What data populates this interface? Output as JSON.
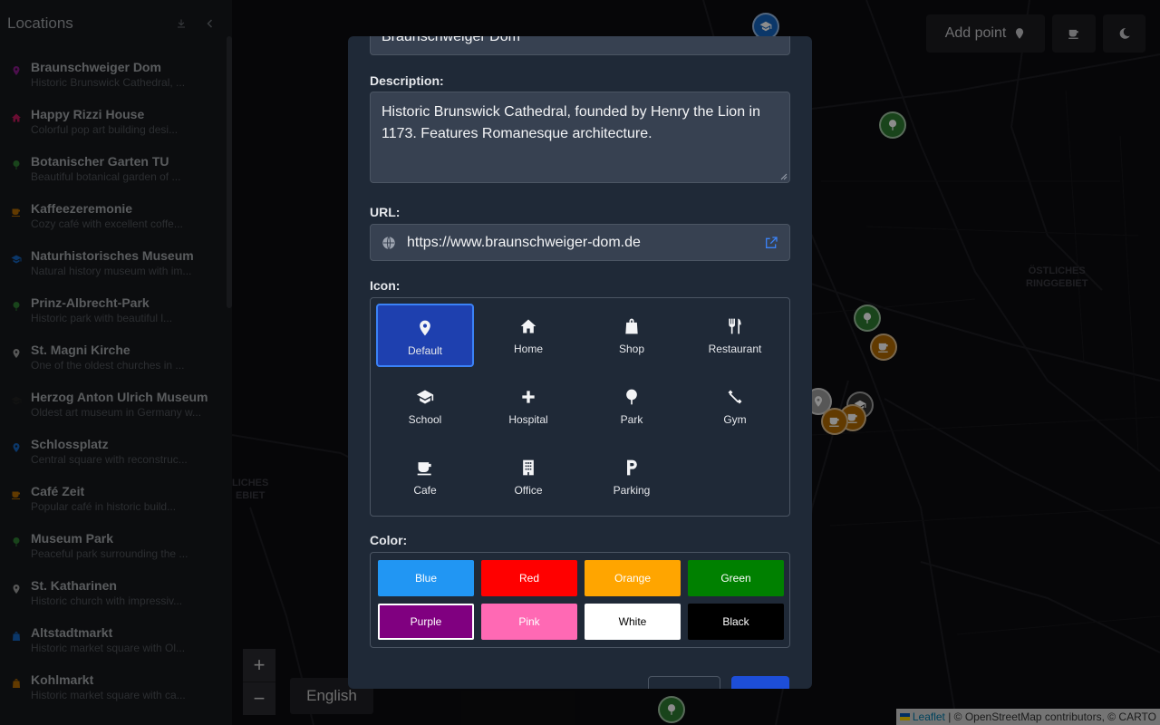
{
  "sidebar": {
    "title": "Locations",
    "items": [
      {
        "name": "Braunschweiger Dom",
        "desc": "Historic Brunswick Cathedral, ...",
        "color": "#8b1a8b",
        "icon": "pin-icon"
      },
      {
        "name": "Happy Rizzi House",
        "desc": "Colorful pop art building desi...",
        "color": "#c2185b",
        "icon": "home-icon"
      },
      {
        "name": "Botanischer Garten TU",
        "desc": "Beautiful botanical garden of ...",
        "color": "#2e7d32",
        "icon": "tree-icon"
      },
      {
        "name": "Kaffeezeremonie",
        "desc": "Cozy café with excellent coffe...",
        "color": "#b26a00",
        "icon": "cafe-icon"
      },
      {
        "name": "Naturhistorisches Museum",
        "desc": "Natural history museum with im...",
        "color": "#1565c0",
        "icon": "school-icon"
      },
      {
        "name": "Prinz-Albrecht-Park",
        "desc": "Historic park with beautiful l...",
        "color": "#2e7d32",
        "icon": "tree-icon"
      },
      {
        "name": "St. Magni Kirche",
        "desc": "One of the oldest churches in ...",
        "color": "#9e9e9e",
        "icon": "pin-icon"
      },
      {
        "name": "Herzog Anton Ulrich Museum",
        "desc": "Oldest art museum in Germany w...",
        "color": "#222222",
        "icon": "school-icon"
      },
      {
        "name": "Schlossplatz",
        "desc": "Central square with reconstruc...",
        "color": "#1565c0",
        "icon": "pin-icon"
      },
      {
        "name": "Café Zeit",
        "desc": "Popular café in historic build...",
        "color": "#b26a00",
        "icon": "cafe-icon"
      },
      {
        "name": "Museum Park",
        "desc": "Peaceful park surrounding the ...",
        "color": "#2e7d32",
        "icon": "tree-icon"
      },
      {
        "name": "St. Katharinen",
        "desc": "Historic church with impressiv...",
        "color": "#9e9e9e",
        "icon": "pin-icon"
      },
      {
        "name": "Altstadtmarkt",
        "desc": "Historic market square with Ol...",
        "color": "#1565c0",
        "icon": "shop-icon"
      },
      {
        "name": "Kohlmarkt",
        "desc": "Historic market square with ca...",
        "color": "#b26a00",
        "icon": "shop-icon"
      }
    ]
  },
  "map": {
    "add_point_label": "Add point",
    "zoom_in": "+",
    "zoom_out": "−",
    "language": "English",
    "area_labels": [
      "ÖSTLICHES\nRINGGEBIET",
      "LICHES\nEBIET"
    ],
    "attribution": {
      "leaflet": "Leaflet",
      "rest": " | © OpenStreetMap contributors, © CARTO"
    }
  },
  "modal": {
    "name_value": "Braunschweiger Dom",
    "description_label": "Description:",
    "description_value": "Historic Brunswick Cathedral, founded by Henry the Lion in 1173. Features Romanesque architecture.",
    "url_label": "URL:",
    "url_value": "https://www.braunschweiger-dom.de",
    "icon_label": "Icon:",
    "icons": [
      {
        "label": "Default",
        "icon": "pin-icon",
        "selected": true
      },
      {
        "label": "Home",
        "icon": "home-icon"
      },
      {
        "label": "Shop",
        "icon": "shop-icon"
      },
      {
        "label": "Restaurant",
        "icon": "restaurant-icon"
      },
      {
        "label": "School",
        "icon": "school-icon"
      },
      {
        "label": "Hospital",
        "icon": "hospital-icon"
      },
      {
        "label": "Park",
        "icon": "tree-icon"
      },
      {
        "label": "Gym",
        "icon": "gym-icon"
      },
      {
        "label": "Cafe",
        "icon": "cafe-icon"
      },
      {
        "label": "Office",
        "icon": "office-icon"
      },
      {
        "label": "Parking",
        "icon": "parking-icon"
      }
    ],
    "color_label": "Color:",
    "colors": [
      {
        "label": "Blue",
        "hex": "#2196f3",
        "text": "#ffffff"
      },
      {
        "label": "Red",
        "hex": "#ff0000",
        "text": "#ffffff"
      },
      {
        "label": "Orange",
        "hex": "#ffa500",
        "text": "#ffffff"
      },
      {
        "label": "Green",
        "hex": "#008000",
        "text": "#ffffff"
      },
      {
        "label": "Purple",
        "hex": "#800080",
        "text": "#ffffff",
        "selected": true
      },
      {
        "label": "Pink",
        "hex": "#ff69b4",
        "text": "#ffffff"
      },
      {
        "label": "White",
        "hex": "#ffffff",
        "text": "#000000"
      },
      {
        "label": "Black",
        "hex": "#000000",
        "text": "#ffffff"
      }
    ]
  }
}
